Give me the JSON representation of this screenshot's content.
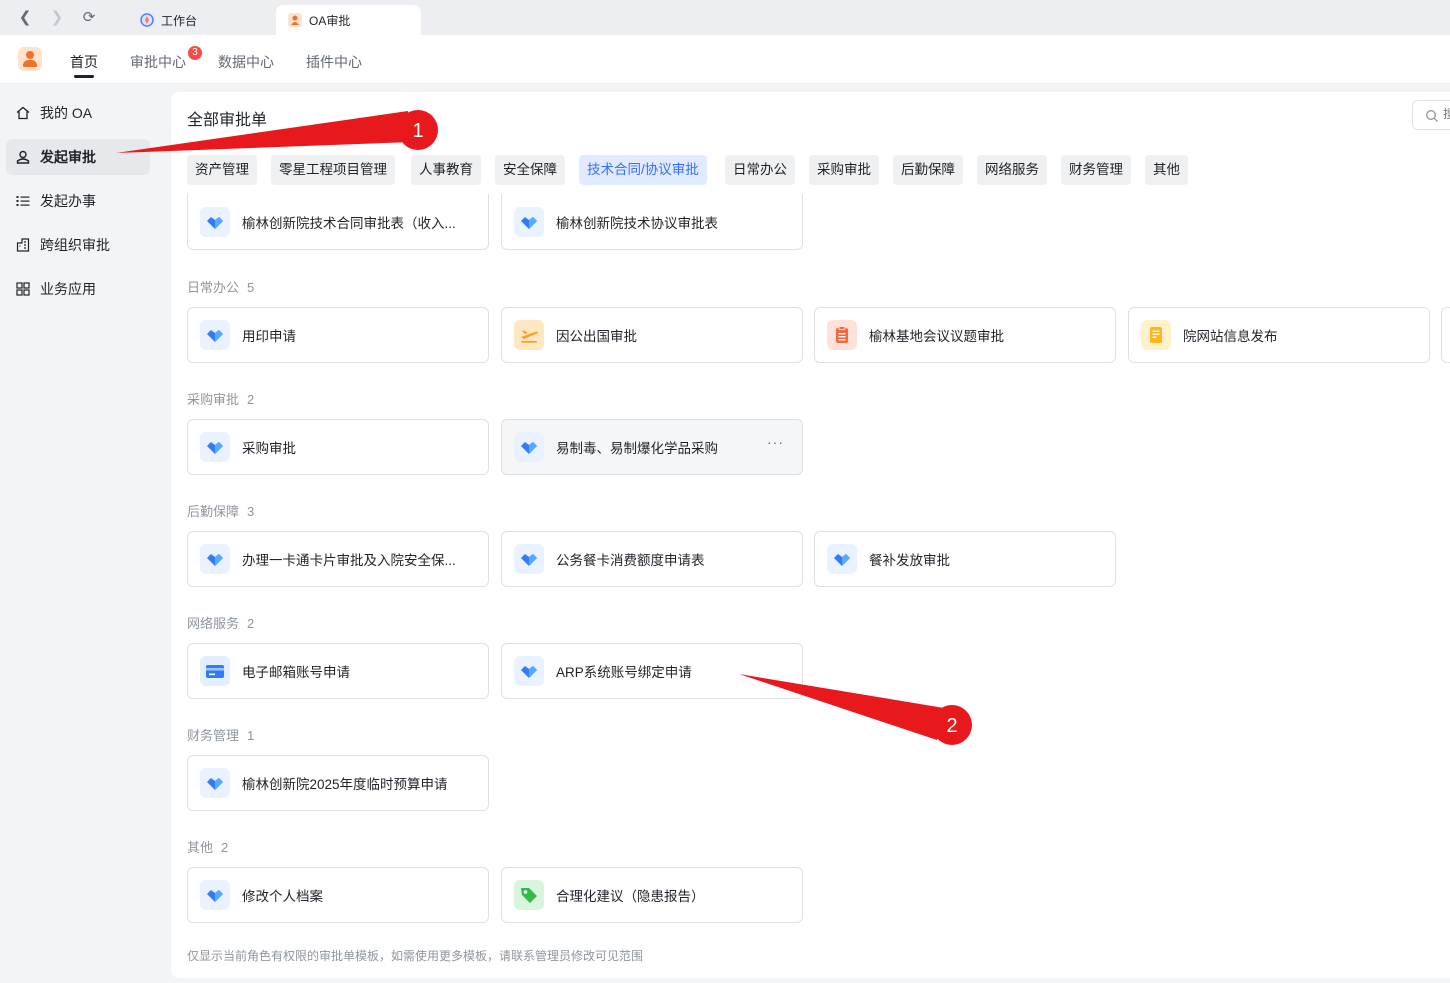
{
  "browser": {
    "tabs": [
      {
        "label": "工作台",
        "active": false
      },
      {
        "label": "OA审批",
        "active": true
      }
    ]
  },
  "header": {
    "nav": [
      {
        "label": "首页",
        "active": true
      },
      {
        "label": "审批中心",
        "badge": "3"
      },
      {
        "label": "数据中心"
      },
      {
        "label": "插件中心"
      }
    ]
  },
  "sidebar": {
    "items": [
      {
        "label": "我的 OA",
        "icon": "home-icon"
      },
      {
        "label": "发起审批",
        "icon": "user-icon",
        "active": true
      },
      {
        "label": "发起办事",
        "icon": "list-icon"
      },
      {
        "label": "跨组织审批",
        "icon": "building-icon"
      },
      {
        "label": "业务应用",
        "icon": "grid-icon"
      }
    ]
  },
  "main": {
    "title": "全部审批单",
    "search_placeholder": "搜",
    "chips": [
      {
        "label": "资产管理"
      },
      {
        "label": "零星工程项目管理"
      },
      {
        "label": "人事教育"
      },
      {
        "label": "安全保障"
      },
      {
        "label": "技术合同/协议审批",
        "active": true
      },
      {
        "label": "日常办公"
      },
      {
        "label": "采购审批"
      },
      {
        "label": "后勤保障"
      },
      {
        "label": "网络服务"
      },
      {
        "label": "财务管理"
      },
      {
        "label": "其他"
      }
    ],
    "tech_cards": [
      {
        "label": "榆林创新院技术合同审批表（收入...",
        "icon": "diamond-icon"
      },
      {
        "label": "榆林创新院技术协议审批表",
        "icon": "diamond-icon"
      }
    ],
    "sections": [
      {
        "name": "日常办公",
        "count": "5",
        "cards": [
          {
            "label": "用印申请",
            "icon": "diamond-icon"
          },
          {
            "label": "因公出国审批",
            "icon": "plane-icon"
          },
          {
            "label": "榆林基地会议议题审批",
            "icon": "clipboard-icon"
          },
          {
            "label": "院网站信息发布",
            "icon": "document-icon"
          }
        ]
      },
      {
        "name": "采购审批",
        "count": "2",
        "cards": [
          {
            "label": "采购审批",
            "icon": "diamond-icon"
          },
          {
            "label": "易制毒、易制爆化学品采购",
            "icon": "diamond-icon",
            "more": "···"
          }
        ]
      },
      {
        "name": "后勤保障",
        "count": "3",
        "cards": [
          {
            "label": "办理一卡通卡片审批及入院安全保...",
            "icon": "diamond-icon"
          },
          {
            "label": "公务餐卡消费额度申请表",
            "icon": "diamond-icon"
          },
          {
            "label": "餐补发放审批",
            "icon": "diamond-icon"
          }
        ]
      },
      {
        "name": "网络服务",
        "count": "2",
        "cards": [
          {
            "label": "电子邮箱账号申请",
            "icon": "card-icon"
          },
          {
            "label": "ARP系统账号绑定申请",
            "icon": "diamond-icon"
          }
        ]
      },
      {
        "name": "财务管理",
        "count": "1",
        "cards": [
          {
            "label": "榆林创新院2025年度临时预算申请",
            "icon": "diamond-icon"
          }
        ]
      },
      {
        "name": "其他",
        "count": "2",
        "cards": [
          {
            "label": "修改个人档案",
            "icon": "diamond-icon"
          },
          {
            "label": "合理化建议（隐患报告）",
            "icon": "tag-icon"
          }
        ]
      }
    ],
    "footer_note": "仅显示当前角色有权限的审批单模板，如需使用更多模板，请联系管理员修改可见范围"
  },
  "annotations": [
    {
      "number": "1"
    },
    {
      "number": "2"
    }
  ],
  "colors": {
    "accent": "#3370ff",
    "badge": "#f54a45",
    "annotation": "#e8191c"
  }
}
